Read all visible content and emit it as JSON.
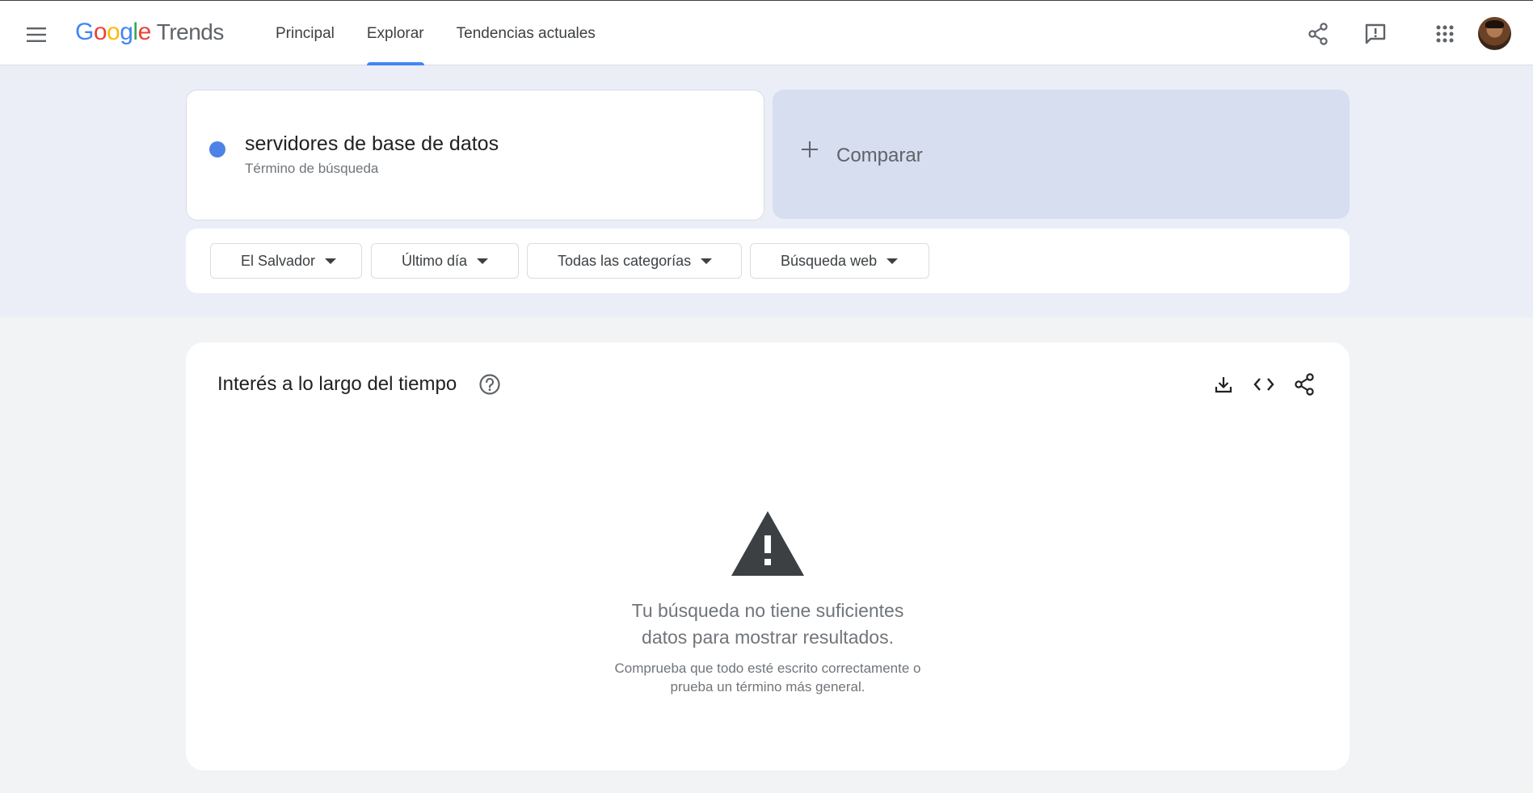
{
  "header": {
    "logo": {
      "google_letters": [
        {
          "char": "G",
          "color": "#4285F4"
        },
        {
          "char": "o",
          "color": "#EA4335"
        },
        {
          "char": "o",
          "color": "#FBBC05"
        },
        {
          "char": "g",
          "color": "#4285F4"
        },
        {
          "char": "l",
          "color": "#34A853"
        },
        {
          "char": "e",
          "color": "#EA4335"
        }
      ],
      "product": "Trends"
    },
    "tabs": [
      {
        "label": "Principal",
        "active": false
      },
      {
        "label": "Explorar",
        "active": true
      },
      {
        "label": "Tendencias actuales",
        "active": false
      }
    ],
    "icons": [
      "menu-icon",
      "share-icon",
      "feedback-icon",
      "apps-grid-icon",
      "avatar"
    ]
  },
  "search": {
    "term": "servidores de base de datos",
    "term_type": "Término de búsqueda",
    "term_color": "#4F82E6",
    "compare_label": "Comparar"
  },
  "filters": {
    "region": "El Salvador",
    "time": "Último día",
    "category": "Todas las categorías",
    "type": "Búsqueda web"
  },
  "interest_card": {
    "title": "Interés a lo largo del tiempo",
    "icons": [
      "help-icon",
      "download-icon",
      "embed-code-icon",
      "share-icon"
    ],
    "message_line1": "Tu búsqueda no tiene suficientes",
    "message_line2": "datos para mostrar resultados.",
    "hint_line1": "Comprueba que todo esté escrito correctamente o",
    "hint_line2": "prueba un término más general."
  },
  "colors": {
    "accent": "#4285F4",
    "band_bg": "#EBEEF7",
    "compare_bg": "#D6DEF0"
  }
}
